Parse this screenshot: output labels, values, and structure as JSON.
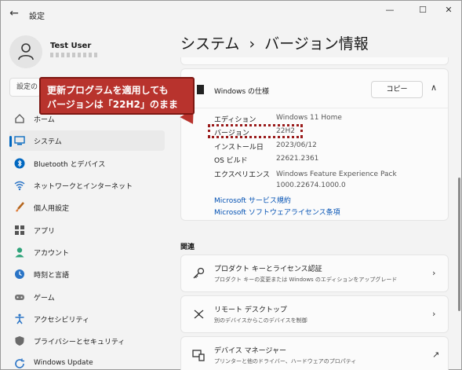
{
  "window": {
    "title": "設定",
    "back_glyph": "←",
    "minimize_glyph": "—",
    "maximize_glyph": "☐",
    "close_glyph": "✕"
  },
  "profile": {
    "name": "Test User"
  },
  "search": {
    "placeholder": "設定の"
  },
  "sidebar": {
    "items": [
      {
        "label": "ホーム",
        "icon": "home-icon"
      },
      {
        "label": "システム",
        "icon": "system-icon",
        "active": true
      },
      {
        "label": "Bluetooth とデバイス",
        "icon": "bluetooth-icon"
      },
      {
        "label": "ネットワークとインターネット",
        "icon": "network-icon"
      },
      {
        "label": "個人用設定",
        "icon": "brush-icon"
      },
      {
        "label": "アプリ",
        "icon": "apps-icon"
      },
      {
        "label": "アカウント",
        "icon": "account-icon"
      },
      {
        "label": "時刻と言語",
        "icon": "clock-icon"
      },
      {
        "label": "ゲーム",
        "icon": "gamepad-icon"
      },
      {
        "label": "アクセシビリティ",
        "icon": "accessibility-icon"
      },
      {
        "label": "プライバシーとセキュリティ",
        "icon": "shield-icon"
      },
      {
        "label": "Windows Update",
        "icon": "update-icon"
      }
    ]
  },
  "page": {
    "breadcrumb_parent": "システム",
    "breadcrumb_sep": "›",
    "breadcrumb_current": "バージョン情報"
  },
  "windows_spec": {
    "title": "Windows の仕様",
    "copy_label": "コピー",
    "chevron_up": "∧",
    "rows": [
      {
        "label": "エディション",
        "value": "Windows 11 Home"
      },
      {
        "label": "バージョン",
        "value": "22H2"
      },
      {
        "label": "インストール日",
        "value": "2023/06/12"
      },
      {
        "label": "OS ビルド",
        "value": "22621.2361"
      },
      {
        "label": "エクスペリエンス",
        "value": "Windows Feature Experience Pack",
        "value2": "1000.22674.1000.0"
      }
    ],
    "links": [
      "Microsoft サービス規約",
      "Microsoft ソフトウェアライセンス条項"
    ]
  },
  "callout": {
    "line1": "更新プログラムを適用しても",
    "line2": "バージョンは「22H2」のまま",
    "color": "#b8332d"
  },
  "related": {
    "label": "関連",
    "cards": [
      {
        "title": "プロダクト キーとライセンス認証",
        "subtitle": "プロダクト キーの変更または Windows のエディションをアップグレード",
        "icon": "key-icon",
        "action": "›"
      },
      {
        "title": "リモート デスクトップ",
        "subtitle": "別のデバイスからこのデバイスを制御",
        "icon": "remote-desktop-icon",
        "action": "›"
      },
      {
        "title": "デバイス マネージャー",
        "subtitle": "プリンターと他のドライバー、ハードウェアのプロパティ",
        "icon": "device-manager-icon",
        "action": "↗"
      }
    ]
  },
  "colors": {
    "accent": "#0067c0",
    "link": "#0050b3",
    "callout": "#b8332d"
  }
}
